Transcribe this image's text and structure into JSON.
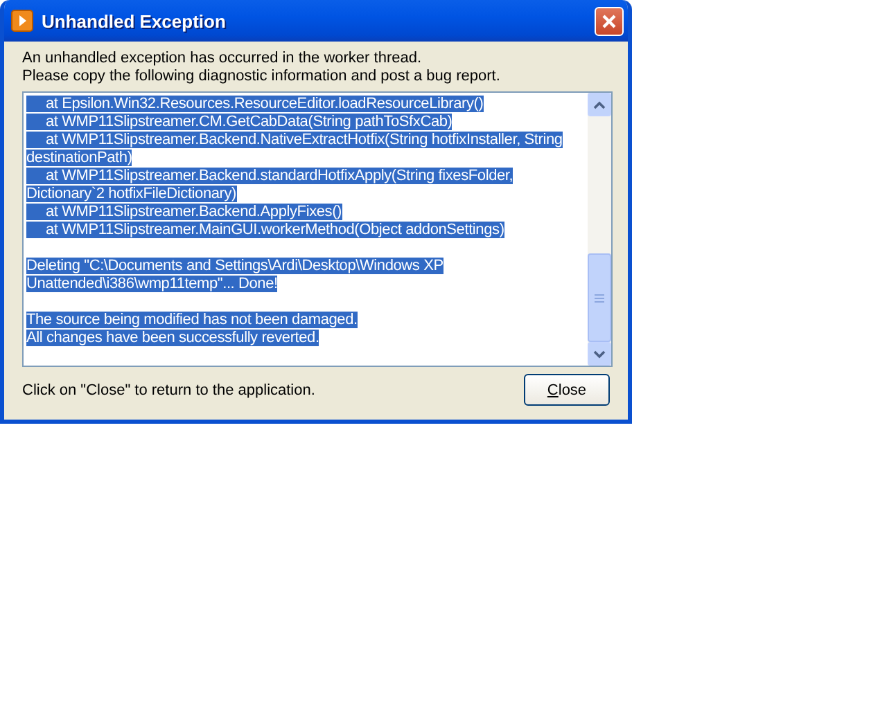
{
  "window": {
    "title": "Unhandled Exception"
  },
  "message": [
    "An unhandled exception has occurred in the worker thread.",
    "Please copy the following diagnostic information and post a bug report."
  ],
  "details": {
    "paragraphs": [
      {
        "selected": true,
        "lines": [
          {
            "text": "at Epsilon.Win32.Resources.ResourceEditor.loadResourceLibrary()",
            "indent": true
          },
          {
            "text": "at WMP11Slipstreamer.CM.GetCabData(String pathToSfxCab)",
            "indent": true
          },
          {
            "text": "at WMP11Slipstreamer.Backend.NativeExtractHotfix(String hotfixInstaller, String",
            "indent": true
          },
          {
            "text": "destinationPath)",
            "indent": false
          },
          {
            "text": "at WMP11Slipstreamer.Backend.standardHotfixApply(String fixesFolder,",
            "indent": true
          },
          {
            "text": "Dictionary`2 hotfixFileDictionary)",
            "indent": false
          },
          {
            "text": "at WMP11Slipstreamer.Backend.ApplyFixes()",
            "indent": true
          },
          {
            "text": "at WMP11Slipstreamer.MainGUI.workerMethod(Object addonSettings)",
            "indent": true
          }
        ]
      },
      {
        "selected": true,
        "lines": [
          {
            "text": "Deleting \"C:\\Documents and Settings\\Ardi\\Desktop\\Windows XP",
            "indent": false
          },
          {
            "text": "Unattended\\i386\\wmp11temp\"...  Done!",
            "indent": false
          }
        ]
      },
      {
        "selected": true,
        "lines": [
          {
            "text": "The source being modified has not been damaged.",
            "indent": false
          },
          {
            "text": "All changes have been successfully reverted.",
            "indent": false
          }
        ]
      }
    ]
  },
  "footer": "Click on \"Close\" to return to the application.",
  "close_button": {
    "label": "Close"
  }
}
